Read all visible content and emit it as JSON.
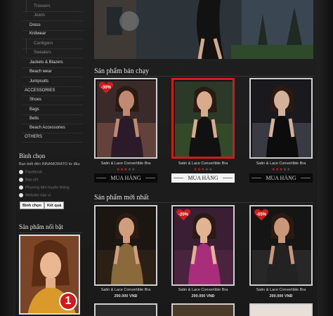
{
  "sidebar": {
    "menu": [
      {
        "label": "Trousers",
        "sub": true
      },
      {
        "label": "Jeans",
        "sub": true
      },
      {
        "label": "Dress",
        "sub": false
      },
      {
        "label": "Knitwear",
        "sub": false
      },
      {
        "label": "Cardigans",
        "sub": true
      },
      {
        "label": "Sweaters",
        "sub": true
      },
      {
        "label": "Jackets & Blazers",
        "sub": false
      },
      {
        "label": "Beach wear",
        "sub": false
      },
      {
        "label": "Jumpsuits",
        "sub": false
      },
      {
        "label": "ACCESSORIES",
        "sub": false
      },
      {
        "label": "Shoes",
        "sub": false
      },
      {
        "label": "Bags",
        "sub": false
      },
      {
        "label": "Belts",
        "sub": false
      },
      {
        "label": "Beach Accessories",
        "sub": false
      },
      {
        "label": "OTHERS",
        "sub": false
      }
    ],
    "poll": {
      "title": "Bình chọn",
      "question": "Bạn biết đến INNAMORATO từ đâu",
      "options": [
        "Facebook",
        "Báo chí",
        "Phương tiện truyền thông",
        "Website nào ví"
      ],
      "vote_label": "Bình chọn",
      "result_label": "Kết quả"
    },
    "featured": {
      "title": "Sản phẩm nổi bật",
      "badge": "1"
    }
  },
  "main": {
    "bestsellers_title": "Sản phẩm bán chạy",
    "new_title": "Sản phẩm mới nhất",
    "buy_label": "MUA HÀNG",
    "bestsellers": [
      {
        "name": "Satin & Lace Convertible Bra",
        "rating": 3,
        "discount": "-30%",
        "active": false
      },
      {
        "name": "Satin & Lace Convertible Bra",
        "rating": 3,
        "discount": "",
        "active": true
      },
      {
        "name": "Satin & Lace Convertible Bra",
        "rating": 3,
        "discount": "",
        "active": false
      }
    ],
    "newest": [
      {
        "name": "Satin & Lace Convertible Bra",
        "price": "290.000 VNĐ",
        "discount": ""
      },
      {
        "name": "Satin & Lace Convertible Bra",
        "price": "290.000 VNĐ",
        "discount": "-20%"
      },
      {
        "name": "Satin & Lace Convertible Bra",
        "price": "290.000 VNĐ",
        "discount": "-05%"
      }
    ]
  },
  "colors": {
    "accent": "#d11b1b",
    "background": "#1b1b1b"
  }
}
